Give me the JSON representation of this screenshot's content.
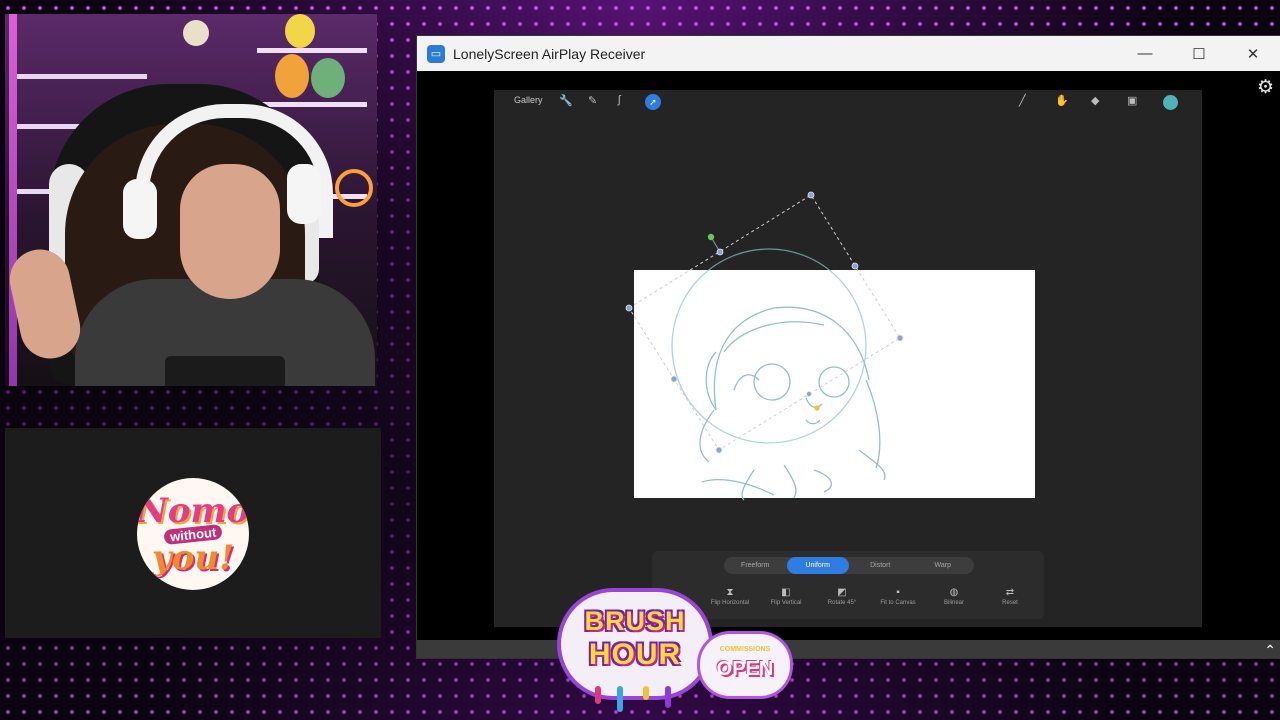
{
  "window": {
    "title": "LonelyScreen AirPlay Receiver",
    "minimize_glyph": "—",
    "maximize_glyph": "☐",
    "close_glyph": "✕",
    "settings_icon": "gear-icon"
  },
  "procreate": {
    "gallery_label": "Gallery",
    "tool_icons": [
      "wrench-icon",
      "magic-wand-icon",
      "selection-icon",
      "transform-icon"
    ],
    "right_tool_icons": [
      "brush-icon",
      "smudge-icon",
      "eraser-icon",
      "layers-icon"
    ],
    "current_color": "#4fb3b8",
    "transform_modes": [
      "Freeform",
      "Uniform",
      "Distort",
      "Warp"
    ],
    "active_mode": "Uniform",
    "transform_actions": [
      "Flip Horizontal",
      "Flip Vertical",
      "Rotate 45°",
      "Fit to Canvas",
      "Bilinear",
      "Reset"
    ]
  },
  "stream": {
    "logo_line1": "Nomo",
    "logo_line2": "without",
    "logo_line3": "you!",
    "brush_line1": "BRUSH",
    "brush_line2": "HOUR",
    "commissions_small": "COMMISSIONS",
    "commissions_big": "OPEN"
  },
  "colors": {
    "accent_blue": "#2f7de0",
    "neon_purple": "#d65aff",
    "logo_pink": "#e23d86"
  }
}
